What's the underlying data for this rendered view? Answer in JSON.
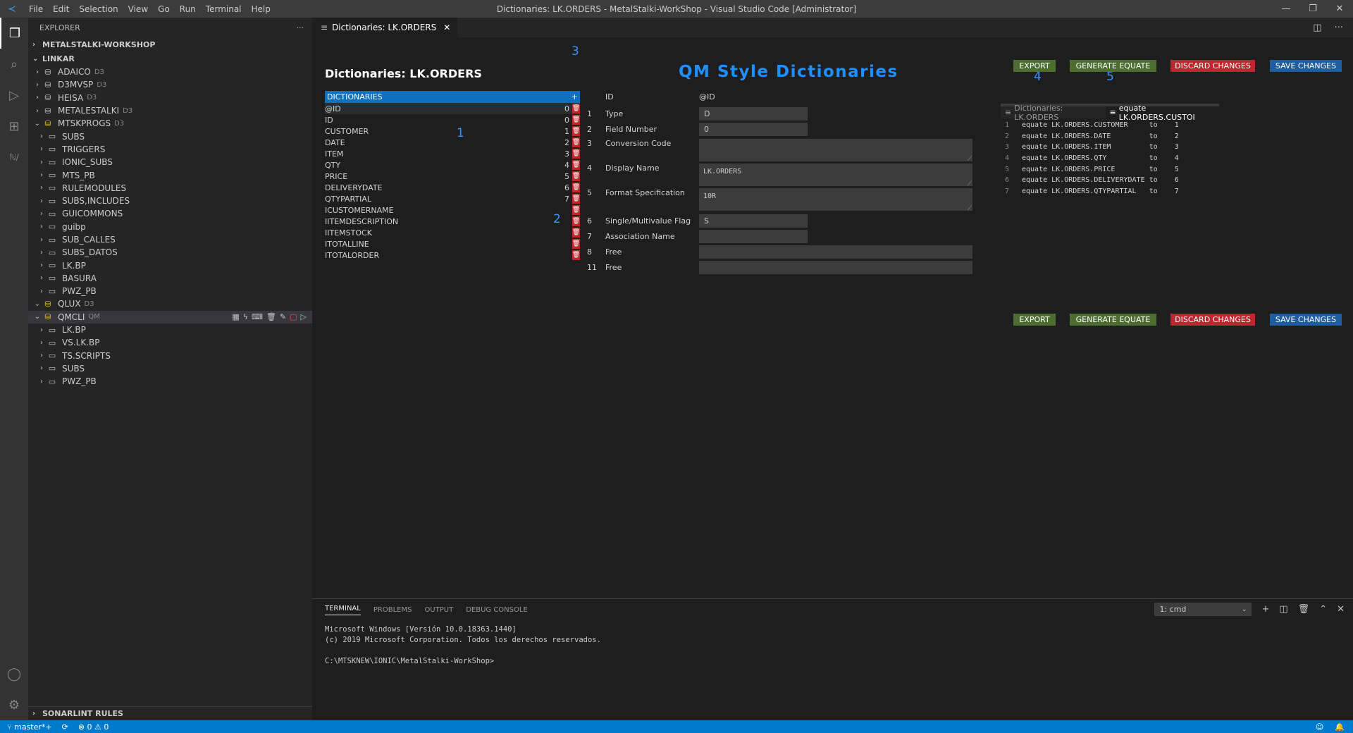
{
  "window": {
    "title": "Dictionaries: LK.ORDERS - MetalStalki-WorkShop - Visual Studio Code [Administrator]",
    "menu": [
      "File",
      "Edit",
      "Selection",
      "View",
      "Go",
      "Run",
      "Terminal",
      "Help"
    ]
  },
  "sidebar": {
    "header": "EXPLORER",
    "workspace": "METALSTALKI-WORKSHOP",
    "section": "LINKAR",
    "tree": [
      {
        "label": "ADAICO",
        "tag": "D3",
        "type": "db",
        "level": 1,
        "open": false
      },
      {
        "label": "D3MVSP",
        "tag": "D3",
        "type": "db",
        "level": 1,
        "open": false
      },
      {
        "label": "HEISA",
        "tag": "D3",
        "type": "db",
        "level": 1,
        "open": false
      },
      {
        "label": "METALESTALKI",
        "tag": "D3",
        "type": "db",
        "level": 1,
        "open": false
      },
      {
        "label": "MTSKPROGS",
        "tag": "D3",
        "type": "db-yellow",
        "level": 1,
        "open": true
      },
      {
        "label": "SUBS",
        "tag": "",
        "type": "folder",
        "level": 2,
        "open": false
      },
      {
        "label": "TRIGGERS",
        "tag": "",
        "type": "folder",
        "level": 2,
        "open": false
      },
      {
        "label": "IONIC_SUBS",
        "tag": "",
        "type": "folder",
        "level": 2,
        "open": false
      },
      {
        "label": "MTS_PB",
        "tag": "",
        "type": "folder",
        "level": 2,
        "open": false
      },
      {
        "label": "RULEMODULES",
        "tag": "",
        "type": "folder",
        "level": 2,
        "open": false
      },
      {
        "label": "SUBS,INCLUDES",
        "tag": "",
        "type": "folder",
        "level": 2,
        "open": false
      },
      {
        "label": "GUICOMMONS",
        "tag": "",
        "type": "folder",
        "level": 2,
        "open": false
      },
      {
        "label": "guibp",
        "tag": "",
        "type": "folder",
        "level": 2,
        "open": false
      },
      {
        "label": "SUB_CALLES",
        "tag": "",
        "type": "folder",
        "level": 2,
        "open": false
      },
      {
        "label": "SUBS_DATOS",
        "tag": "",
        "type": "folder",
        "level": 2,
        "open": false
      },
      {
        "label": "LK.BP",
        "tag": "",
        "type": "folder",
        "level": 2,
        "open": false
      },
      {
        "label": "BASURA",
        "tag": "",
        "type": "folder",
        "level": 2,
        "open": false
      },
      {
        "label": "PWZ_PB",
        "tag": "",
        "type": "folder",
        "level": 2,
        "open": false
      },
      {
        "label": "QLUX",
        "tag": "D3",
        "type": "db-yellow",
        "level": 1,
        "open": true
      },
      {
        "label": "QMCLI",
        "tag": "QM",
        "type": "db-yellow",
        "level": 1,
        "open": true,
        "selected": true
      },
      {
        "label": "LK.BP",
        "tag": "",
        "type": "folder",
        "level": 2,
        "open": false
      },
      {
        "label": "VS.LK.BP",
        "tag": "",
        "type": "folder",
        "level": 2,
        "open": false
      },
      {
        "label": "TS.SCRIPTS",
        "tag": "",
        "type": "folder",
        "level": 2,
        "open": false
      },
      {
        "label": "SUBS",
        "tag": "",
        "type": "folder",
        "level": 2,
        "open": false
      },
      {
        "label": "PWZ_PB",
        "tag": "",
        "type": "folder",
        "level": 2,
        "open": false
      }
    ],
    "bottom_section": "SONARLINT RULES"
  },
  "editor": {
    "tab_label": "Dictionaries: LK.ORDERS",
    "dict_title": "Dictionaries: LK.ORDERS",
    "main_title": "QM Style Dictionaries",
    "annotations": {
      "a1": "1",
      "a2": "2",
      "a3": "3",
      "a4": "4",
      "a5": "5"
    },
    "list_header": "DICTIONARIES",
    "add_symbol": "+",
    "dictionaries": [
      {
        "name": "@ID",
        "num": "0"
      },
      {
        "name": "ID",
        "num": "0"
      },
      {
        "name": "CUSTOMER",
        "num": "1"
      },
      {
        "name": "DATE",
        "num": "2"
      },
      {
        "name": "ITEM",
        "num": "3"
      },
      {
        "name": "QTY",
        "num": "4"
      },
      {
        "name": "PRICE",
        "num": "5"
      },
      {
        "name": "DELIVERYDATE",
        "num": "6"
      },
      {
        "name": "QTYPARTIAL",
        "num": "7"
      },
      {
        "name": "ICUSTOMERNAME",
        "num": ""
      },
      {
        "name": "IITEMDESCRIPTION",
        "num": ""
      },
      {
        "name": "IITEMSTOCK",
        "num": ""
      },
      {
        "name": "ITOTALLINE",
        "num": ""
      },
      {
        "name": "ITOTALORDER",
        "num": ""
      }
    ],
    "form": {
      "id_label": "ID",
      "id_value": "@ID",
      "fields": [
        {
          "num": "1",
          "label": "Type",
          "value": "D"
        },
        {
          "num": "2",
          "label": "Field Number",
          "value": "0"
        },
        {
          "num": "3",
          "label": "Conversion Code",
          "value": ""
        },
        {
          "num": "4",
          "label": "Display Name",
          "value": "LK.ORDERS"
        },
        {
          "num": "5",
          "label": "Format Specification",
          "value": "10R"
        },
        {
          "num": "6",
          "label": "Single/Multivalue Flag",
          "value": "S"
        },
        {
          "num": "7",
          "label": "Association Name",
          "value": ""
        },
        {
          "num": "8",
          "label": "Free",
          "value": ""
        },
        {
          "num": "11",
          "label": "Free",
          "value": ""
        }
      ]
    },
    "buttons": {
      "export": "EXPORT",
      "generate": "GENERATE EQUATE",
      "discard": "DISCARD CHANGES",
      "save": "SAVE CHANGES"
    },
    "colors": {
      "green": "#4e6e31",
      "red": "#c0262d",
      "blue": "#1f5e9e",
      "accent": "#1e90ff"
    },
    "preview": {
      "tabs": [
        "Dictionaries: LK.ORDERS",
        "equate LK.ORDERS.CUSTOI"
      ],
      "lines": [
        {
          "n": "1",
          "text": "equate LK.ORDERS.CUSTOMER     to    1"
        },
        {
          "n": "2",
          "text": "equate LK.ORDERS.DATE         to    2"
        },
        {
          "n": "3",
          "text": "equate LK.ORDERS.ITEM         to    3"
        },
        {
          "n": "4",
          "text": "equate LK.ORDERS.QTY          to    4"
        },
        {
          "n": "5",
          "text": "equate LK.ORDERS.PRICE        to    5"
        },
        {
          "n": "6",
          "text": "equate LK.ORDERS.DELIVERYDATE to    6"
        },
        {
          "n": "7",
          "text": "equate LK.ORDERS.QTYPARTIAL   to    7"
        }
      ]
    }
  },
  "panel": {
    "tabs": [
      "TERMINAL",
      "PROBLEMS",
      "OUTPUT",
      "DEBUG CONSOLE"
    ],
    "terminal_select": "1: cmd",
    "terminal_lines": [
      "Microsoft Windows [Versión 10.0.18363.1440]",
      "(c) 2019 Microsoft Corporation. Todos los derechos reservados.",
      "",
      "C:\\MTSKNEW\\IONIC\\MetalStalki-WorkShop>"
    ]
  },
  "status": {
    "branch": "master*+",
    "problems": "⊗ 0 ⚠ 0"
  }
}
